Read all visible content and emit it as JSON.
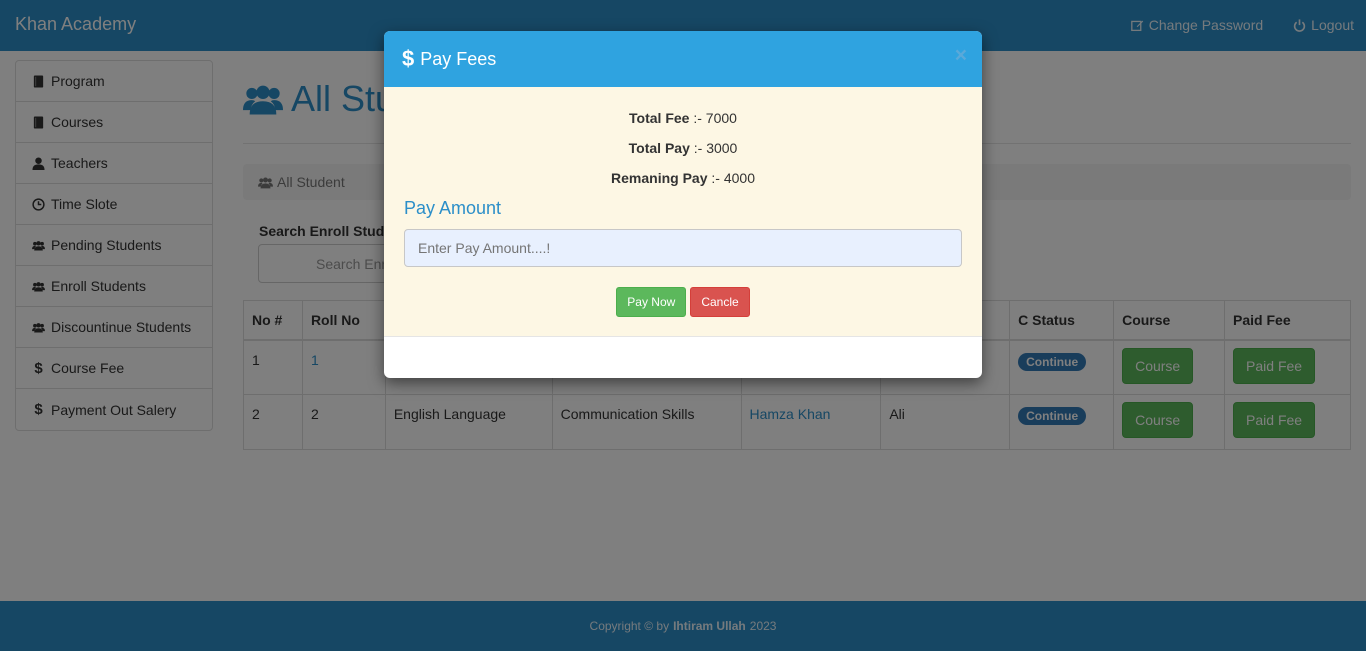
{
  "navbar": {
    "brand": "Khan Academy",
    "change_password": "Change Password",
    "logout": "Logout"
  },
  "sidebar": {
    "items": [
      {
        "label": "Program",
        "icon": "book-icon"
      },
      {
        "label": "Courses",
        "icon": "book-icon"
      },
      {
        "label": "Teachers",
        "icon": "user-icon"
      },
      {
        "label": "Time Slote",
        "icon": "clock-icon"
      },
      {
        "label": "Pending Students",
        "icon": "users-icon"
      },
      {
        "label": "Enroll Students",
        "icon": "users-icon"
      },
      {
        "label": "Discountinue Students",
        "icon": "users-icon"
      },
      {
        "label": "Course Fee",
        "icon": "dollar-icon"
      },
      {
        "label": "Payment Out Salery",
        "icon": "dollar-icon"
      }
    ]
  },
  "main": {
    "title": "All Stu",
    "breadcrumb": "All Student",
    "search_label": "Search Enroll Studs",
    "search_value": "Search Enr"
  },
  "table": {
    "headers": [
      "No #",
      "Roll No",
      "",
      "",
      "",
      "",
      "C Status",
      "Course",
      "Paid Fee"
    ],
    "rows": [
      {
        "no": "1",
        "roll": "1",
        "course": "",
        "subject": "",
        "teacher": "",
        "name": "",
        "status": "Continue",
        "course_btn": "Course",
        "fee_btn": "Paid Fee"
      },
      {
        "no": "2",
        "roll": "2",
        "course": "English Language",
        "subject": "Communication Skills",
        "teacher": "Hamza Khan",
        "name": "Ali",
        "status": "Continue",
        "course_btn": "Course",
        "fee_btn": "Paid Fee"
      }
    ]
  },
  "footer": {
    "prefix": "Copyright © by",
    "author": "Ihtiram Ullah",
    "year": "2023"
  },
  "modal": {
    "title": "Pay Fees",
    "close": "×",
    "total_fee_label": "Total Fee",
    "total_fee_value": ":- 7000",
    "total_pay_label": "Total Pay",
    "total_pay_value": ":- 3000",
    "remaining_label": "Remaning Pay",
    "remaining_value": ":- 4000",
    "pay_amount_label": "Pay Amount",
    "pay_amount_placeholder": "Enter Pay Amount....!",
    "pay_now": "Pay Now",
    "cancel": "Cancle"
  },
  "colors": {
    "primary": "#2c8fc9",
    "modal_header": "#2fa3e0",
    "success": "#5cb85c",
    "danger": "#d9534f",
    "modal_body": "#fdf7e4"
  }
}
